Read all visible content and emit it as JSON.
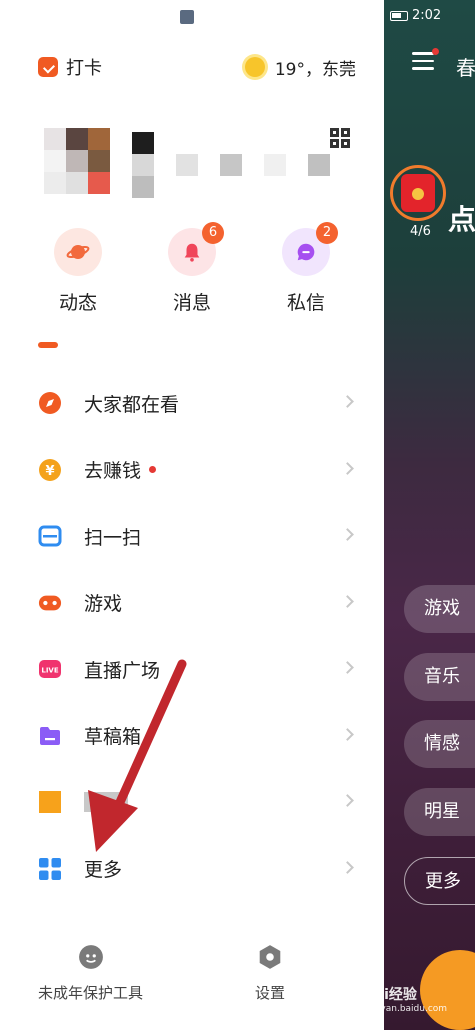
{
  "status_bar": {
    "time": "2:02"
  },
  "drawer": {
    "checkin_label": "打卡",
    "weather": "19°，东莞",
    "quick_actions": [
      {
        "label": "动态",
        "badge": null,
        "color": "#f26a3d",
        "bg": "#fde7e1"
      },
      {
        "label": "消息",
        "badge": "6",
        "color": "#f0465a",
        "bg": "#fde4e6"
      },
      {
        "label": "私信",
        "badge": "2",
        "color": "#a64ff0",
        "bg": "#f1e5fd"
      }
    ],
    "menu_items": [
      {
        "label": "大家都在看",
        "icon": "compass-icon",
        "color": "#f05a22",
        "dot": false
      },
      {
        "label": "去赚钱",
        "icon": "yen-coin-icon",
        "color": "#f4a21c",
        "dot": true
      },
      {
        "label": "扫一扫",
        "icon": "scan-icon",
        "color": "#2f8cf0",
        "dot": false
      },
      {
        "label": "游戏",
        "icon": "gamepad-icon",
        "color": "#f05a22",
        "dot": false
      },
      {
        "label": "直播广场",
        "icon": "live-icon",
        "color": "#f0336e",
        "dot": false
      },
      {
        "label": "草稿箱",
        "icon": "draft-box-icon",
        "color": "#8b5cf6",
        "dot": false
      },
      {
        "label": "",
        "icon": "orange-square-icon",
        "color": "#f7a21b",
        "dot": false,
        "blurred": true
      },
      {
        "label": "更多",
        "icon": "grid-icon",
        "color": "#2f8cf0",
        "dot": false
      }
    ],
    "bottom": [
      {
        "label": "未成年保护工具",
        "icon": "child-protection-icon"
      },
      {
        "label": "设置",
        "icon": "settings-icon"
      }
    ]
  },
  "background_app": {
    "title": "春",
    "redpack_count": "4/6",
    "big_text": "点",
    "chips": [
      "游戏",
      "音乐",
      "情感",
      "明星",
      "更多"
    ]
  },
  "watermark": {
    "brand": "Bai经验",
    "url": "jingyan.baidu.com"
  }
}
